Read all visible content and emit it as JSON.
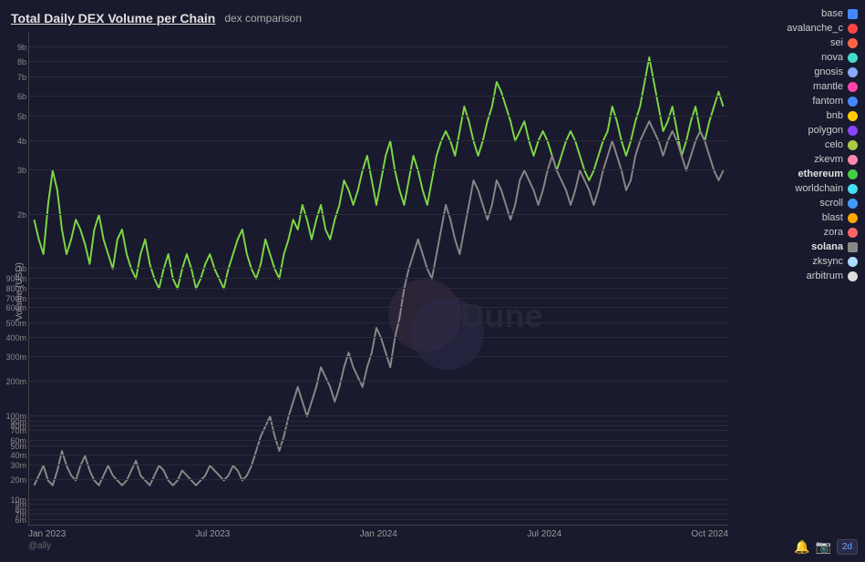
{
  "title": "Total Daily DEX Volume per Chain",
  "subtitle": "dex comparison",
  "y_axis_label": "Volume (USD)",
  "attribution": "@ally",
  "duration": "2d",
  "x_axis_labels": [
    "Jan 2023",
    "Jul 2023",
    "Jan 2024",
    "Jul 2024",
    "Oct 2024"
  ],
  "y_axis_ticks": [
    {
      "label": "9b",
      "pct": 97
    },
    {
      "label": "8b",
      "pct": 94
    },
    {
      "label": "7b",
      "pct": 91
    },
    {
      "label": "6b",
      "pct": 87
    },
    {
      "label": "5b",
      "pct": 83
    },
    {
      "label": "4b",
      "pct": 78
    },
    {
      "label": "3b",
      "pct": 72
    },
    {
      "label": "2b",
      "pct": 63
    },
    {
      "label": "1b",
      "pct": 52
    },
    {
      "label": "900m",
      "pct": 50
    },
    {
      "label": "800m",
      "pct": 48
    },
    {
      "label": "700m",
      "pct": 46
    },
    {
      "label": "600m",
      "pct": 44
    },
    {
      "label": "500m",
      "pct": 41
    },
    {
      "label": "400m",
      "pct": 38
    },
    {
      "label": "300m",
      "pct": 34
    },
    {
      "label": "200m",
      "pct": 29
    },
    {
      "label": "100m",
      "pct": 22
    },
    {
      "label": "90m",
      "pct": 21
    },
    {
      "label": "80m",
      "pct": 20
    },
    {
      "label": "70m",
      "pct": 19
    },
    {
      "label": "60m",
      "pct": 17
    },
    {
      "label": "50m",
      "pct": 16
    },
    {
      "label": "40m",
      "pct": 14
    },
    {
      "label": "30m",
      "pct": 12
    },
    {
      "label": "20m",
      "pct": 9
    },
    {
      "label": "10m",
      "pct": 5
    },
    {
      "label": "9m",
      "pct": 4
    },
    {
      "label": "8m",
      "pct": 3
    },
    {
      "label": "7m",
      "pct": 2
    },
    {
      "label": "6m",
      "pct": 1
    }
  ],
  "legend_items": [
    {
      "label": "base",
      "color": "#4488ff",
      "shape": "square"
    },
    {
      "label": "avalanche_c",
      "color": "#ff4444",
      "shape": "circle"
    },
    {
      "label": "sei",
      "color": "#ff6644",
      "shape": "circle"
    },
    {
      "label": "nova",
      "color": "#44ddcc",
      "shape": "circle"
    },
    {
      "label": "gnosis",
      "color": "#88aaff",
      "shape": "circle"
    },
    {
      "label": "mantle",
      "color": "#ff44aa",
      "shape": "circle"
    },
    {
      "label": "fantom",
      "color": "#4488ff",
      "shape": "circle"
    },
    {
      "label": "bnb",
      "color": "#ffcc00",
      "shape": "circle"
    },
    {
      "label": "polygon",
      "color": "#8844ff",
      "shape": "circle"
    },
    {
      "label": "celo",
      "color": "#aacc44",
      "shape": "circle"
    },
    {
      "label": "zkevm",
      "color": "#ff88aa",
      "shape": "circle"
    },
    {
      "label": "ethereum",
      "color": "#44cc44",
      "shape": "circle",
      "bold": true
    },
    {
      "label": "worldchain",
      "color": "#44ddee",
      "shape": "circle"
    },
    {
      "label": "scroll",
      "color": "#4499ff",
      "shape": "circle"
    },
    {
      "label": "blast",
      "color": "#ffaa00",
      "shape": "circle"
    },
    {
      "label": "zora",
      "color": "#ff6666",
      "shape": "circle"
    },
    {
      "label": "solana",
      "color": "#888888",
      "shape": "square",
      "bold": true
    },
    {
      "label": "zksync",
      "color": "#aaddff",
      "shape": "circle"
    },
    {
      "label": "arbitrum",
      "color": "#dddddd",
      "shape": "circle"
    }
  ]
}
